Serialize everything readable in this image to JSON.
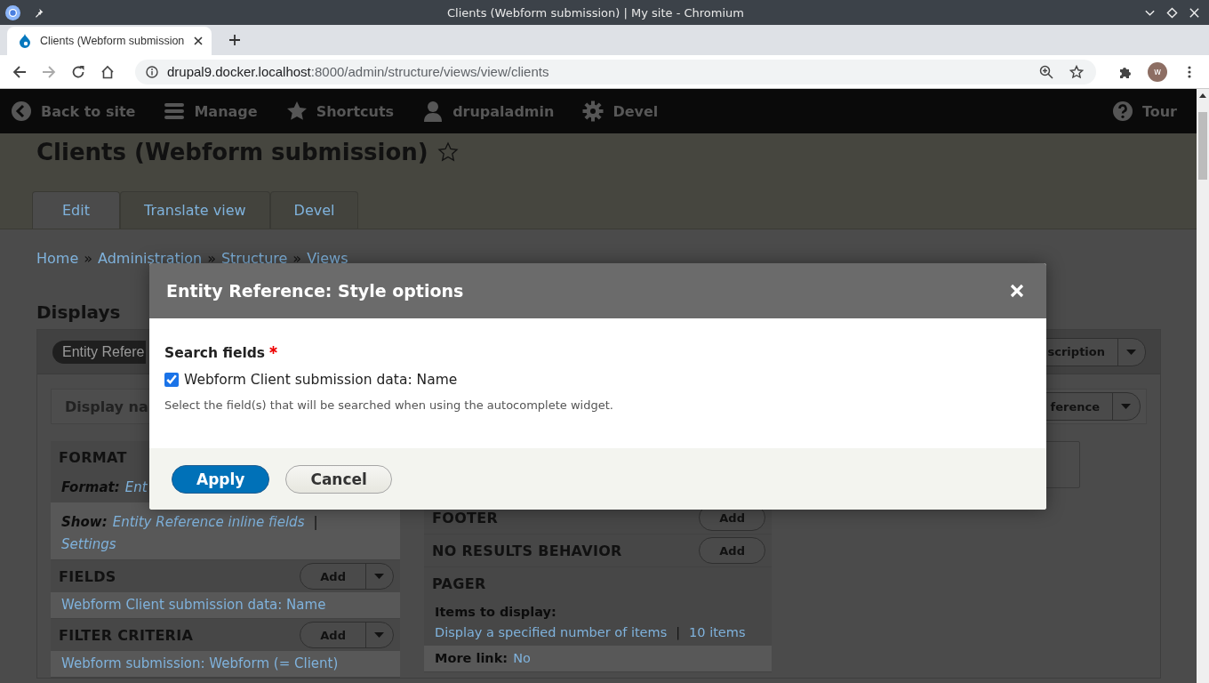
{
  "browser": {
    "window_title": "Clients (Webform submission) | My site - Chromium",
    "tabs": [
      {
        "title": "Clients (Webform submission",
        "selected": true
      }
    ],
    "url_host": "drupal9.docker.localhost",
    "url_path": ":8000/admin/structure/views/view/clients",
    "avatar": "w"
  },
  "toolbar": {
    "items": [
      {
        "label": "Back to site",
        "kind": "back"
      },
      {
        "label": "Manage",
        "kind": "menu"
      },
      {
        "label": "Shortcuts",
        "kind": "star"
      },
      {
        "label": "drupaladmin",
        "kind": "user"
      },
      {
        "label": "Devel",
        "kind": "gear"
      }
    ],
    "tour": "Tour"
  },
  "page": {
    "title": "Clients (Webform submission)",
    "tabs": [
      {
        "label": "Edit",
        "selected": true
      },
      {
        "label": "Translate view",
        "selected": false
      },
      {
        "label": "Devel",
        "selected": false
      }
    ],
    "breadcrumb": [
      {
        "text": "Home",
        "kind": "link"
      },
      {
        "text": "»",
        "kind": "sep"
      },
      {
        "text": "Administration",
        "kind": "link"
      },
      {
        "text": "»",
        "kind": "sep"
      },
      {
        "text": "Structure",
        "kind": "link"
      },
      {
        "text": "»",
        "kind": "sep"
      },
      {
        "text": "Views",
        "kind": "link"
      }
    ],
    "displays_heading": "Displays",
    "display_tab": "Entity Refere",
    "display_action": "scription",
    "display_name_label": "Display na",
    "display_name_action": "ference",
    "left_sections": [
      {
        "title": "FORMAT",
        "rows": [
          {
            "shaded": false,
            "parts": [
              {
                "text": "Format:",
                "kind": "italic-label"
              },
              {
                "text": "Ent",
                "kind": "italic-link"
              }
            ]
          },
          {
            "shaded": true,
            "parts": [
              {
                "text": "Show:",
                "kind": "italic-label"
              },
              {
                "text": "Entity Reference inline fields",
                "kind": "italic-link"
              },
              {
                "text": "|",
                "kind": "sep"
              },
              {
                "text": "Settings",
                "kind": "italic-link"
              }
            ]
          }
        ]
      },
      {
        "title": "FIELDS",
        "button": "Add",
        "dropdown": true,
        "rows": [
          {
            "shaded": true,
            "parts": [
              {
                "text": "Webform Client submission data: Name",
                "kind": "link"
              }
            ]
          }
        ]
      },
      {
        "title": "FILTER CRITERIA",
        "button": "Add",
        "dropdown": true,
        "rows": [
          {
            "shaded": true,
            "parts": [
              {
                "text": "Webform submission: Webform (= Client)",
                "kind": "link"
              }
            ]
          }
        ]
      }
    ],
    "mid_sections": [
      {
        "title": "FOOTER",
        "button": "Add",
        "dropdown": false
      },
      {
        "title": "NO RESULTS BEHAVIOR",
        "button": "Add",
        "dropdown": false
      },
      {
        "title": "PAGER",
        "rows": [
          {
            "shaded": false,
            "parts": [
              {
                "text": "Items to display:",
                "kind": "block-label"
              },
              {
                "text": "Display a specified number of items",
                "kind": "link"
              },
              {
                "text": "|",
                "kind": "sep"
              },
              {
                "text": "10 items",
                "kind": "link"
              }
            ]
          },
          {
            "shaded": true,
            "parts": [
              {
                "text": "More link:",
                "kind": "label"
              },
              {
                "text": "No",
                "kind": "link"
              }
            ]
          }
        ]
      }
    ]
  },
  "modal": {
    "title": "Entity Reference: Style options",
    "field_label": "Search fields",
    "required": true,
    "options": [
      {
        "label": "Webform Client submission data: Name",
        "checked": true
      }
    ],
    "description": "Select the field(s) that will be searched when using the autocomplete widget.",
    "buttons": [
      {
        "label": "Apply",
        "kind": "primary"
      },
      {
        "label": "Cancel",
        "kind": "secondary"
      }
    ]
  }
}
